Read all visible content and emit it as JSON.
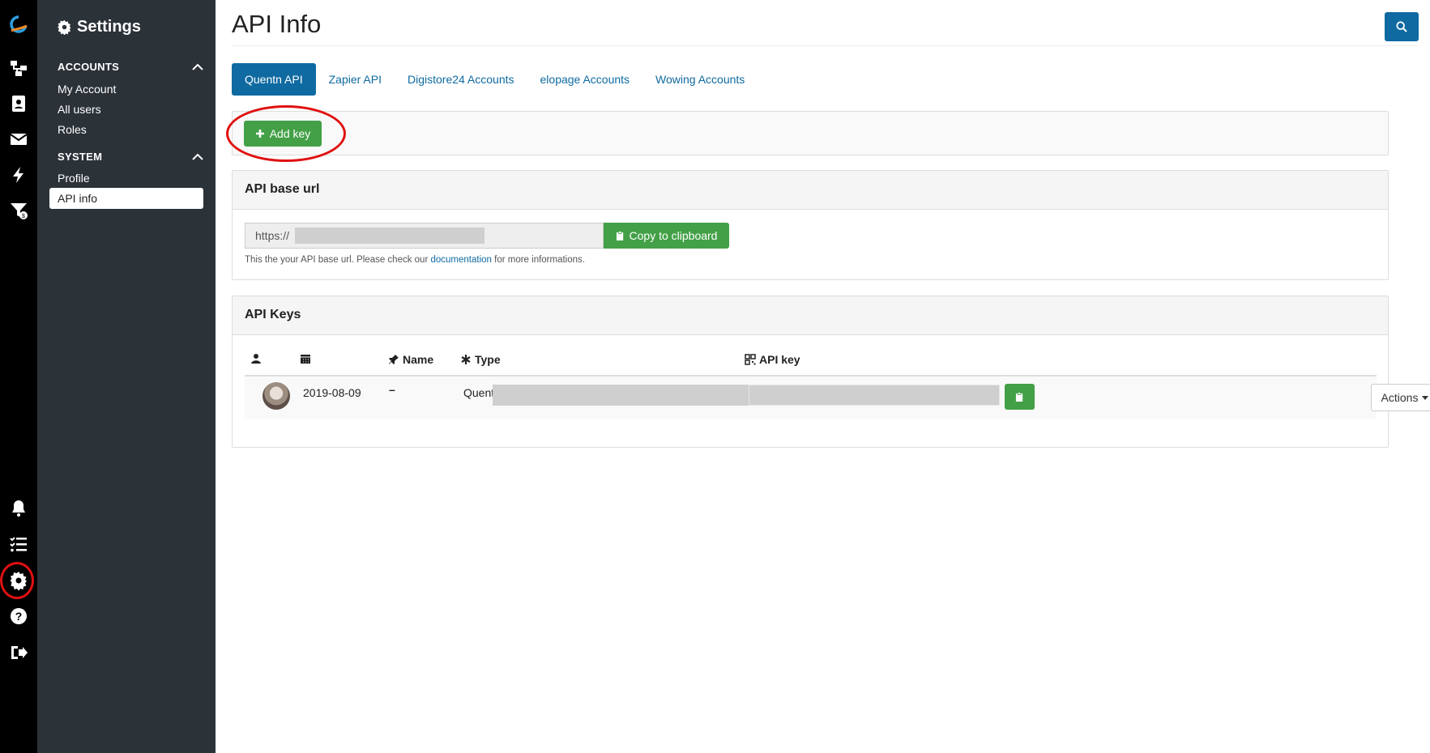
{
  "sidebar": {
    "title": "Settings",
    "sections": [
      {
        "label": "ACCOUNTS",
        "items": [
          "My Account",
          "All users",
          "Roles"
        ]
      },
      {
        "label": "SYSTEM",
        "items": [
          "Profile",
          "API info"
        ]
      }
    ],
    "active_item": "API info"
  },
  "rail": {
    "top_icons": [
      "logo-icon",
      "sitemap-icon",
      "contacts-icon",
      "envelope-icon",
      "bolt-icon",
      "funnel-dollar-icon"
    ],
    "bottom_icons": [
      "bell-icon",
      "tasks-icon",
      "gear-icon",
      "help-icon",
      "logout-icon"
    ]
  },
  "header": {
    "title": "API Info",
    "search_icon": "search-icon"
  },
  "tabs": [
    {
      "label": "Quentn API",
      "active": true
    },
    {
      "label": "Zapier API",
      "active": false
    },
    {
      "label": "Digistore24 Accounts",
      "active": false
    },
    {
      "label": "elopage Accounts",
      "active": false
    },
    {
      "label": "Wowing Accounts",
      "active": false
    }
  ],
  "toolbar": {
    "add_key_label": "Add key"
  },
  "base_url_panel": {
    "title": "API base url",
    "url_value": "https://",
    "copy_label": "Copy to clipboard",
    "help_prefix": "This the your API base url. Please check our ",
    "help_link": "documentation",
    "help_suffix": " for more informations."
  },
  "keys_panel": {
    "title": "API Keys",
    "columns": {
      "user": "",
      "date": "",
      "name": "Name",
      "type": "Type",
      "api_key": "API key"
    },
    "rows": [
      {
        "date": "2019-08-09",
        "name": "–",
        "type": "Quentn",
        "api_key": "",
        "actions_label": "Actions"
      }
    ]
  },
  "colors": {
    "primary": "#0f6aa1",
    "success": "#43a047",
    "sidebar": "#2b3238",
    "rail": "#000000",
    "highlight": "#e01010"
  }
}
